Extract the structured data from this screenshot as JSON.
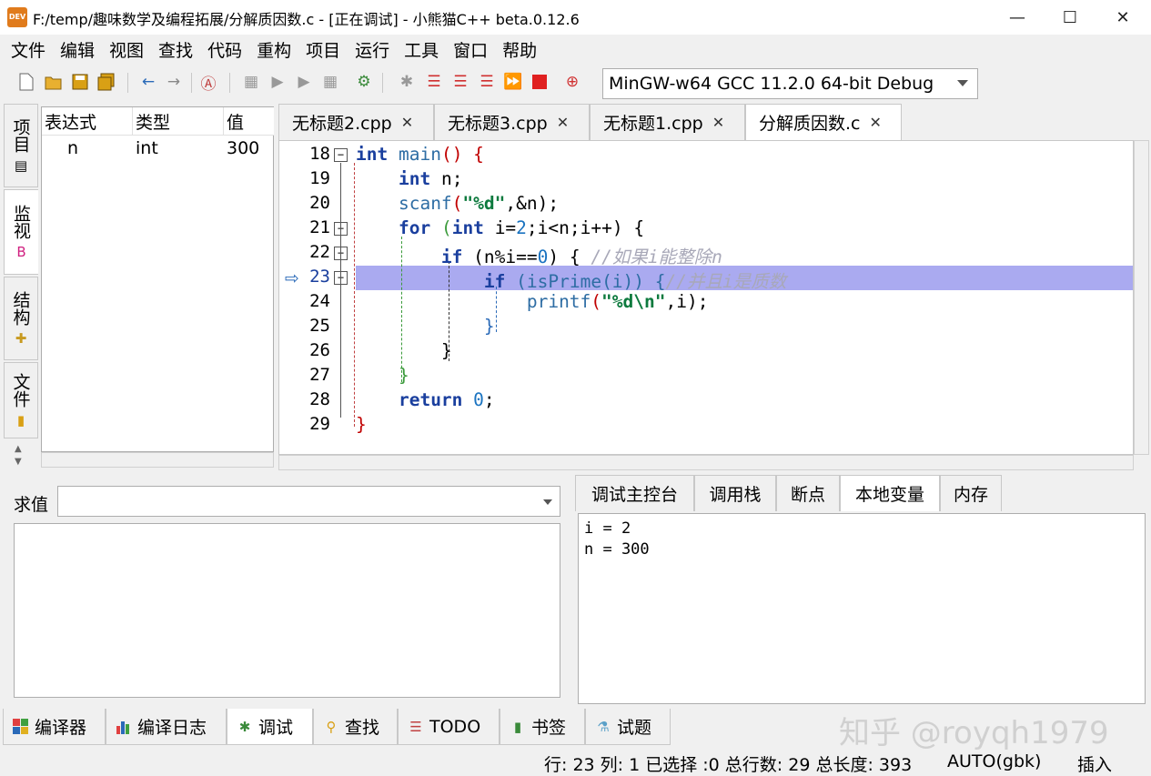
{
  "window": {
    "title": "F:/temp/趣味数学及编程拓展/分解质因数.c - [正在调试] - 小熊猫C++ beta.0.12.6",
    "icon_text": "DEV",
    "controls": {
      "minimize": "—",
      "maximize": "☐",
      "close": "✕"
    }
  },
  "menu": [
    "文件",
    "编辑",
    "视图",
    "查找",
    "代码",
    "重构",
    "项目",
    "运行",
    "工具",
    "窗口",
    "帮助"
  ],
  "toolbar": {
    "compiler": "MinGW-w64 GCC 11.2.0 64-bit Debug"
  },
  "left_tabs": [
    "项目",
    "监视",
    "结构",
    "文件"
  ],
  "watch": {
    "headers": [
      "表达式",
      "类型",
      "值"
    ],
    "rows": [
      {
        "expr": "n",
        "type": "int",
        "value": "300"
      }
    ]
  },
  "editor_tabs": [
    {
      "label": "无标题2.cpp"
    },
    {
      "label": "无标题3.cpp"
    },
    {
      "label": "无标题1.cpp"
    },
    {
      "label": "分解质因数.c"
    }
  ],
  "tab_close": "✕",
  "code_lines": [
    {
      "num": "18",
      "fold": "−"
    },
    {
      "num": "19",
      "fold": ""
    },
    {
      "num": "20",
      "fold": ""
    },
    {
      "num": "21",
      "fold": "−"
    },
    {
      "num": "22",
      "fold": "−"
    },
    {
      "num": "23",
      "fold": "−"
    },
    {
      "num": "24",
      "fold": ""
    },
    {
      "num": "25",
      "fold": ""
    },
    {
      "num": "26",
      "fold": ""
    },
    {
      "num": "27",
      "fold": ""
    },
    {
      "num": "28",
      "fold": ""
    },
    {
      "num": "29",
      "fold": ""
    }
  ],
  "code": {
    "l18": {
      "kw": "int",
      "fn": "main",
      "p": "() {"
    },
    "l19": {
      "kw": "int",
      "rest": "n;"
    },
    "l20": {
      "fn": "scanf",
      "p1": "(",
      "str": "\"%d\"",
      "rest": ",&n);"
    },
    "l21": {
      "kw": "for",
      "p1": "(",
      "kw2": "int",
      "rest1": "i=",
      "num": "2",
      "rest2": ";i<n;i++) {"
    },
    "l22": {
      "kw": "if",
      "p1": "(n%i==",
      "num": "0",
      "p2": ") {",
      "cmt": "//如果i能整除n"
    },
    "l23": {
      "kw": "if",
      "p1": "(",
      "fn": "isPrime",
      "p2": "(i)) {",
      "cmt": "//并且i是质数"
    },
    "l24": {
      "fn": "printf",
      "p1": "(",
      "str": "\"%d\\n\"",
      "rest": ",i);"
    },
    "l25": {
      "p": "}"
    },
    "l26": {
      "p": "}"
    },
    "l27": {
      "p": "}"
    },
    "l28": {
      "kw": "return",
      "num": "0",
      "p": ";"
    },
    "l29": {
      "p": "}"
    }
  },
  "eval": {
    "label": "求值",
    "value": ""
  },
  "debug_tabs": [
    "调试主控台",
    "调用栈",
    "断点",
    "本地变量",
    "内存"
  ],
  "local_vars": [
    "i = 2",
    "n = 300"
  ],
  "bottom_tabs": [
    "编译器",
    "编译日志",
    "调试",
    "查找",
    "TODO",
    "书签",
    "试题"
  ],
  "status": {
    "position": "行: 23 列: 1 已选择 :0 总行数: 29 总长度: 393",
    "encoding": "AUTO(gbk)",
    "mode": "插入"
  },
  "watermark": "知乎 @royqh1979"
}
